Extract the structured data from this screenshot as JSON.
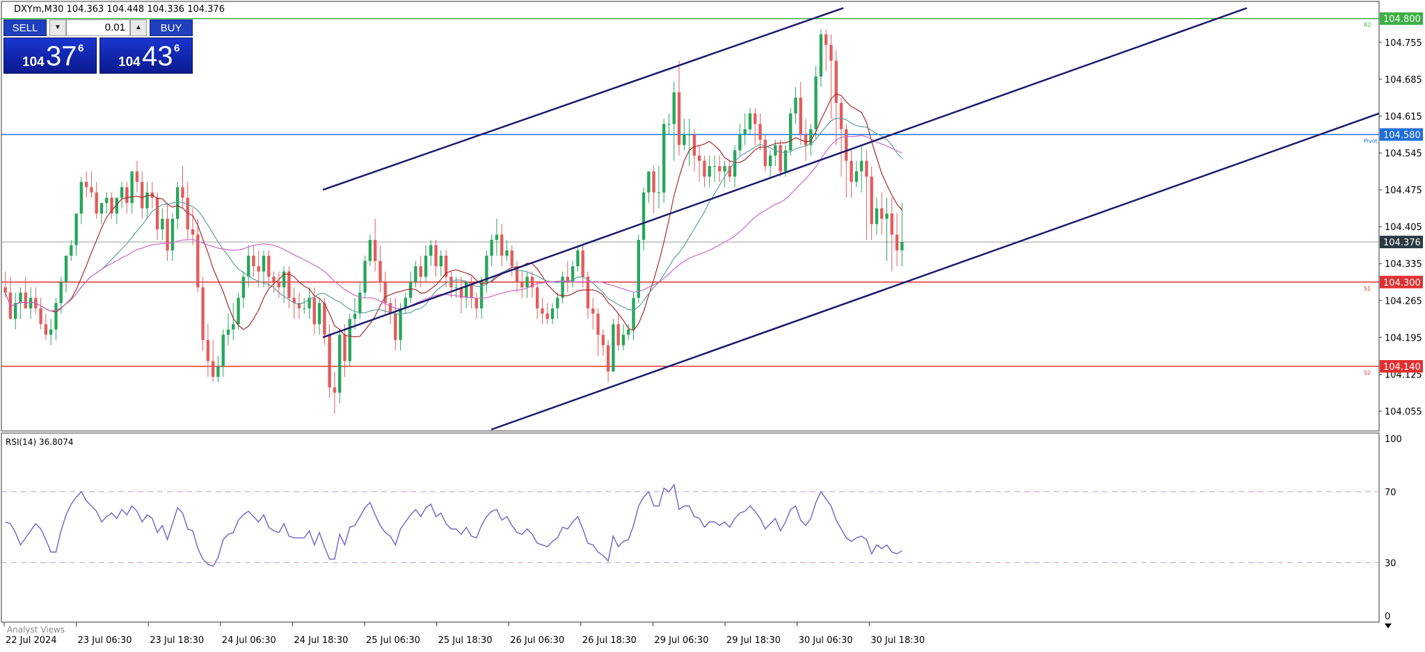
{
  "chart_data": [
    {
      "type": "candlestick",
      "title": "DXYm,M30  104.363 104.448 104.336 104.376",
      "ylim": [
        104.02,
        104.83
      ],
      "y_ticks": [
        "104.055",
        "104.125",
        "104.195",
        "104.265",
        "104.335",
        "104.405",
        "104.475",
        "104.545",
        "104.615",
        "104.685",
        "104.755"
      ],
      "x_labels": [
        "22 Jul 2024",
        "23 Jul 06:30",
        "23 Jul 18:30",
        "24 Jul 06:30",
        "24 Jul 18:30",
        "25 Jul 06:30",
        "25 Jul 18:30",
        "26 Jul 06:30",
        "26 Jul 18:30",
        "29 Jul 06:30",
        "29 Jul 18:30",
        "30 Jul 06:30",
        "30 Jul 18:30"
      ],
      "current_price": {
        "value": 104.376,
        "label": "104.376"
      },
      "levels": [
        {
          "name": "R2",
          "value": 104.8,
          "label": "104.800",
          "color": "#3cb043"
        },
        {
          "name": "Pivot",
          "value": 104.58,
          "label": "104.580",
          "color": "#1e6fd9"
        },
        {
          "name": "S1",
          "value": 104.3,
          "label": "104.300",
          "color": "#e03131"
        },
        {
          "name": "S2",
          "value": 104.14,
          "label": "104.140",
          "color": "#e03131"
        }
      ],
      "trendlines": [
        {
          "from": [
            "24 Jul 18:30",
            104.475
          ],
          "to": [
            "30 Jul 06:30",
            104.82
          ]
        },
        {
          "from": [
            "24 Jul 18:30",
            104.195
          ],
          "to": [
            "30 Jul 18:30",
            104.82
          ]
        },
        {
          "from": [
            "25 Jul 18:30",
            104.02
          ],
          "to": [
            "30 Jul 18:30",
            104.62
          ]
        }
      ],
      "candles": {
        "open": [
          104.29,
          104.28,
          104.23,
          104.26,
          104.28,
          104.25,
          104.27,
          104.25,
          104.22,
          104.2,
          104.21,
          104.26,
          104.3,
          104.35,
          104.37,
          104.43,
          104.49,
          104.48,
          104.47,
          104.43,
          104.45,
          104.46,
          104.43,
          104.46,
          104.48,
          104.45,
          104.51,
          104.49,
          104.44,
          104.47,
          104.46,
          104.4,
          104.42,
          104.36,
          104.42,
          104.48,
          104.46,
          104.4,
          104.39,
          104.29,
          104.19,
          104.15,
          104.12,
          104.14,
          104.2,
          104.21,
          104.22,
          104.27,
          104.31,
          104.35,
          104.33,
          104.32,
          104.35,
          104.31,
          104.3,
          104.29,
          104.32,
          104.27,
          104.26,
          104.25,
          104.25,
          104.27,
          104.22,
          104.26,
          104.2,
          104.1,
          104.09,
          104.2,
          104.15,
          104.23,
          104.24,
          104.28,
          104.34,
          104.38,
          104.34,
          104.3,
          104.26,
          104.24,
          104.19,
          104.25,
          104.27,
          104.3,
          104.33,
          104.31,
          104.35,
          104.37,
          104.33,
          104.35,
          104.31,
          104.29,
          104.29,
          104.27,
          104.3,
          104.27,
          104.25,
          104.3,
          104.35,
          104.38,
          104.39,
          104.35,
          104.36,
          104.33,
          104.3,
          104.29,
          104.31,
          104.29,
          104.25,
          104.24,
          104.23,
          104.25,
          104.27,
          104.31,
          104.3,
          104.33,
          104.36,
          104.31,
          104.25,
          104.24,
          104.2,
          104.18,
          104.13,
          104.22,
          104.18,
          104.2,
          104.21,
          104.27,
          104.38,
          104.47,
          104.51,
          104.47,
          104.47,
          104.6,
          104.6,
          104.66,
          104.56,
          104.58,
          104.58,
          104.54,
          104.53,
          104.5,
          104.52,
          104.52,
          104.51,
          104.52,
          104.5,
          104.55,
          104.58,
          104.59,
          104.62,
          104.6,
          104.57,
          104.52,
          104.54,
          104.56,
          104.51,
          104.55,
          104.62,
          104.65,
          104.58,
          104.56,
          104.59,
          104.69,
          104.77,
          104.75,
          104.72,
          104.64,
          104.59,
          104.53,
          104.49,
          104.51,
          104.53,
          104.5,
          104.41,
          104.44,
          104.42,
          104.43,
          104.39,
          104.36
        ],
        "high": [
          104.32,
          104.31,
          104.28,
          104.29,
          104.31,
          104.29,
          104.29,
          104.27,
          104.24,
          104.23,
          104.27,
          104.31,
          104.35,
          104.38,
          104.43,
          104.5,
          104.51,
          104.51,
          104.49,
          104.45,
          104.47,
          104.47,
          104.46,
          104.49,
          104.49,
          104.51,
          104.53,
          104.51,
          104.49,
          104.49,
          104.47,
          104.44,
          104.45,
          104.43,
          104.49,
          104.52,
          104.49,
          104.44,
          104.42,
          104.31,
          104.22,
          104.19,
          104.16,
          104.21,
          104.24,
          104.26,
          104.28,
          104.32,
          104.37,
          104.37,
          104.36,
          104.36,
          104.36,
          104.32,
          104.32,
          104.33,
          104.33,
          104.29,
          104.28,
          104.27,
          104.29,
          104.29,
          104.27,
          104.27,
          104.22,
          104.13,
          104.21,
          104.22,
          104.24,
          104.27,
          104.3,
          104.35,
          104.39,
          104.42,
          104.37,
          104.32,
          104.27,
          104.27,
          104.26,
          104.28,
          104.32,
          104.34,
          104.35,
          104.37,
          104.38,
          104.38,
          104.36,
          104.36,
          104.32,
          104.31,
          104.31,
          104.3,
          104.31,
          104.28,
          104.31,
          104.36,
          104.39,
          104.42,
          104.41,
          104.38,
          104.37,
          104.34,
          104.32,
          104.32,
          104.32,
          104.3,
          104.27,
          104.26,
          104.26,
          104.28,
          104.32,
          104.34,
          104.34,
          104.37,
          104.37,
          104.32,
          104.27,
          104.25,
          104.21,
          104.19,
          104.23,
          104.24,
          104.22,
          104.22,
          104.28,
          104.39,
          104.48,
          104.51,
          104.52,
          104.52,
          104.61,
          104.62,
          104.68,
          104.72,
          104.61,
          104.61,
          104.59,
          104.56,
          104.54,
          104.54,
          104.54,
          104.54,
          104.53,
          104.53,
          104.56,
          104.6,
          104.62,
          104.63,
          104.63,
          104.62,
          104.58,
          104.55,
          104.57,
          104.57,
          104.56,
          104.63,
          104.67,
          104.68,
          104.61,
          104.6,
          104.71,
          104.78,
          104.78,
          104.77,
          104.74,
          104.65,
          104.6,
          104.55,
          104.53,
          104.56,
          104.55,
          104.52,
          104.46,
          104.47,
          104.46,
          104.46,
          104.43,
          104.45
        ],
        "low": [
          104.27,
          104.27,
          104.21,
          104.23,
          104.25,
          104.23,
          104.24,
          104.21,
          104.19,
          104.18,
          104.19,
          104.24,
          104.28,
          104.34,
          104.35,
          104.41,
          104.46,
          104.46,
          104.42,
          104.41,
          104.43,
          104.42,
          104.41,
          104.44,
          104.43,
          104.43,
          104.47,
          104.42,
          104.42,
          104.44,
          104.38,
          104.38,
          104.34,
          104.34,
          104.4,
          104.44,
          104.38,
          104.37,
          104.28,
          104.17,
          104.12,
          104.11,
          104.11,
          104.12,
          104.18,
          104.19,
          104.21,
          104.25,
          104.29,
          104.31,
          104.29,
          104.29,
          104.29,
          104.28,
          104.27,
          104.26,
          104.25,
          104.23,
          104.23,
          104.24,
          104.23,
          104.2,
          104.2,
          104.18,
          104.08,
          104.05,
          104.07,
          104.12,
          104.14,
          104.21,
          104.23,
          104.27,
          104.33,
          104.32,
          104.28,
          104.24,
          104.22,
          104.17,
          104.17,
          104.24,
          104.26,
          104.29,
          104.29,
          104.3,
          104.33,
          104.31,
          104.31,
          104.29,
          104.27,
          104.27,
          104.24,
          104.25,
          104.25,
          104.23,
          104.23,
          104.28,
          104.33,
          104.35,
          104.33,
          104.34,
          104.31,
          104.28,
          104.27,
          104.27,
          104.27,
          104.23,
          104.22,
          104.22,
          104.22,
          104.23,
          104.26,
          104.28,
          104.29,
          104.32,
          104.29,
          104.23,
          104.21,
          104.16,
          104.16,
          104.11,
          104.13,
          104.17,
          104.17,
          104.19,
          104.19,
          104.26,
          104.36,
          104.45,
          104.43,
          104.44,
          104.45,
          104.58,
          104.53,
          104.54,
          104.55,
          104.52,
          104.51,
          104.49,
          104.48,
          104.48,
          104.49,
          104.49,
          104.48,
          104.49,
          104.48,
          104.54,
          104.56,
          104.58,
          104.56,
          104.55,
          104.51,
          104.5,
          104.52,
          104.5,
          104.5,
          104.54,
          104.6,
          104.56,
          104.53,
          104.54,
          104.57,
          104.67,
          104.7,
          104.61,
          104.56,
          104.5,
          104.46,
          104.46,
          104.48,
          104.47,
          104.38,
          104.38,
          104.39,
          104.39,
          104.34,
          104.32,
          104.33,
          104.33
        ],
        "close": [
          104.28,
          104.23,
          104.26,
          104.28,
          104.25,
          104.27,
          104.25,
          104.22,
          104.2,
          104.21,
          104.26,
          104.3,
          104.35,
          104.37,
          104.43,
          104.49,
          104.48,
          104.47,
          104.43,
          104.45,
          104.46,
          104.43,
          104.46,
          104.48,
          104.45,
          104.51,
          104.49,
          104.44,
          104.47,
          104.46,
          104.4,
          104.42,
          104.36,
          104.42,
          104.48,
          104.46,
          104.4,
          104.39,
          104.29,
          104.19,
          104.15,
          104.12,
          104.14,
          104.2,
          104.21,
          104.22,
          104.27,
          104.31,
          104.35,
          104.33,
          104.32,
          104.35,
          104.31,
          104.3,
          104.29,
          104.32,
          104.27,
          104.26,
          104.25,
          104.25,
          104.27,
          104.22,
          104.26,
          104.2,
          104.1,
          104.09,
          104.2,
          104.15,
          104.23,
          104.24,
          104.28,
          104.34,
          104.38,
          104.34,
          104.3,
          104.26,
          104.24,
          104.19,
          104.25,
          104.27,
          104.3,
          104.33,
          104.31,
          104.35,
          104.37,
          104.33,
          104.35,
          104.31,
          104.29,
          104.29,
          104.27,
          104.3,
          104.27,
          104.25,
          104.3,
          104.35,
          104.38,
          104.39,
          104.35,
          104.36,
          104.33,
          104.3,
          104.29,
          104.31,
          104.29,
          104.25,
          104.24,
          104.23,
          104.25,
          104.27,
          104.31,
          104.3,
          104.33,
          104.36,
          104.31,
          104.25,
          104.24,
          104.2,
          104.18,
          104.13,
          104.22,
          104.18,
          104.2,
          104.21,
          104.27,
          104.38,
          104.47,
          104.51,
          104.47,
          104.47,
          104.6,
          104.6,
          104.66,
          104.56,
          104.58,
          104.58,
          104.54,
          104.53,
          104.5,
          104.52,
          104.52,
          104.51,
          104.52,
          104.5,
          104.55,
          104.58,
          104.59,
          104.62,
          104.6,
          104.57,
          104.52,
          104.54,
          104.56,
          104.51,
          104.55,
          104.62,
          104.65,
          104.58,
          104.56,
          104.59,
          104.69,
          104.77,
          104.75,
          104.72,
          104.64,
          104.59,
          104.53,
          104.49,
          104.51,
          104.53,
          104.5,
          104.41,
          104.44,
          104.42,
          104.43,
          104.39,
          104.36,
          104.376
        ]
      },
      "moving_averages": [
        {
          "color": "#a52a2a"
        },
        {
          "color": "#5f9ea0"
        },
        {
          "color": "#cc66cc"
        }
      ],
      "colors": {
        "up": "#26a65b",
        "down": "#e25c5c"
      }
    },
    {
      "type": "line",
      "title": "RSI(14) 36.8074",
      "ylim": [
        0,
        100
      ],
      "y_ticks": [
        "100",
        "70",
        "30",
        "0"
      ],
      "levels": [
        70,
        30
      ],
      "values": [
        53,
        52,
        47,
        40,
        44,
        48,
        52,
        49,
        43,
        36,
        36,
        48,
        57,
        63,
        67,
        70,
        65,
        62,
        59,
        53,
        56,
        58,
        55,
        60,
        57,
        62,
        59,
        53,
        57,
        55,
        47,
        51,
        43,
        52,
        61,
        58,
        49,
        48,
        38,
        32,
        29,
        28,
        33,
        43,
        46,
        47,
        54,
        57,
        59,
        56,
        53,
        57,
        50,
        48,
        47,
        52,
        45,
        44,
        44,
        44,
        48,
        40,
        47,
        39,
        32,
        32,
        46,
        40,
        50,
        51,
        56,
        61,
        64,
        57,
        51,
        47,
        45,
        40,
        49,
        53,
        57,
        60,
        56,
        61,
        63,
        56,
        58,
        52,
        49,
        49,
        46,
        50,
        45,
        44,
        51,
        56,
        59,
        60,
        54,
        56,
        51,
        47,
        46,
        49,
        46,
        41,
        40,
        39,
        42,
        44,
        50,
        49,
        53,
        56,
        49,
        41,
        40,
        36,
        34,
        31,
        45,
        39,
        42,
        43,
        51,
        62,
        67,
        70,
        62,
        62,
        72,
        70,
        74,
        60,
        62,
        62,
        56,
        55,
        50,
        53,
        53,
        51,
        53,
        50,
        55,
        58,
        59,
        62,
        59,
        55,
        49,
        52,
        55,
        48,
        53,
        60,
        62,
        54,
        51,
        55,
        64,
        70,
        66,
        62,
        54,
        49,
        44,
        42,
        44,
        45,
        43,
        35,
        40,
        38,
        40,
        36,
        35,
        36.8
      ]
    }
  ],
  "trade_panel": {
    "sell_label": "SELL",
    "buy_label": "BUY",
    "volume": "0.01",
    "bid_small": "104",
    "bid_big": "37",
    "bid_sup": "6",
    "ask_small": "104",
    "ask_big": "43",
    "ask_sup": "6"
  },
  "analyst_tab": "Analyst Views"
}
